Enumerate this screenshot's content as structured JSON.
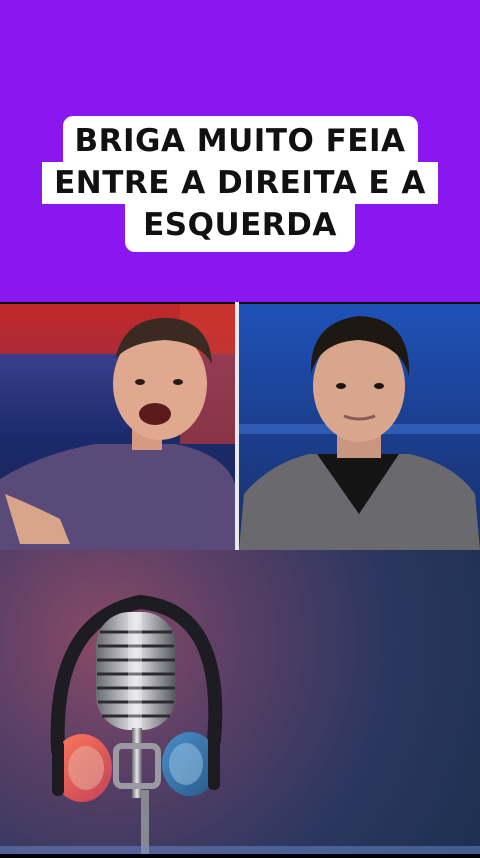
{
  "caption": {
    "line1": "BRIGA MUITO FEIA",
    "line2": "ENTRE A DIREITA E A",
    "line3": "ESQUERDA"
  },
  "colors": {
    "background": "#8a16f0",
    "caption_box": "#ffffff",
    "caption_text": "#111111"
  },
  "video": {
    "left_speaker_icon": "man-speaking-gesturing",
    "right_speaker_icon": "man-listening"
  },
  "illustration": {
    "icon": "microphone-with-headphones-icon"
  }
}
